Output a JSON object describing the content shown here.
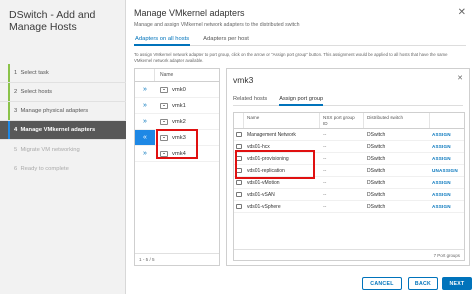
{
  "wizard": {
    "title": "DSwitch - Add and Manage Hosts",
    "steps": [
      {
        "num": "1",
        "label": "Select task"
      },
      {
        "num": "2",
        "label": "Select hosts"
      },
      {
        "num": "3",
        "label": "Manage physical adapters"
      },
      {
        "num": "4",
        "label": "Manage VMkernel adapters"
      },
      {
        "num": "5",
        "label": "Migrate VM networking"
      },
      {
        "num": "6",
        "label": "Ready to complete"
      }
    ]
  },
  "page": {
    "title": "Manage VMkernel adapters",
    "subtitle": "Manage and assign VMkernel network adapters to the distributed switch",
    "tabs": [
      "Adapters on all hosts",
      "Adapters per host"
    ],
    "instructions": "To assign VMkernel network adapter to port group, click on the arrow or \"Assign port group\" button. This assignment would be applied to all hosts that have the same VMkernel network adapter available."
  },
  "vmk_table": {
    "header": "Name",
    "rows": [
      "vmk0",
      "vmk1",
      "vmk2",
      "vmk3",
      "vmk4"
    ],
    "footer": "1 - 5 / 5"
  },
  "detail": {
    "title": "vmk3",
    "tabs": [
      "Related hosts",
      "Assign port group"
    ],
    "columns": [
      "Name",
      "NSX port group ID",
      "Distributed switch",
      ""
    ],
    "rows": [
      {
        "name": "Management Network",
        "nsx": "--",
        "switch": "DSwitch",
        "action": "ASSIGN"
      },
      {
        "name": "vds01-hcx",
        "nsx": "--",
        "switch": "DSwitch",
        "action": "ASSIGN"
      },
      {
        "name": "vds01-provisioning",
        "nsx": "--",
        "switch": "DSwitch",
        "action": "ASSIGN"
      },
      {
        "name": "vds01-replication",
        "nsx": "--",
        "switch": "DSwitch",
        "action": "UNASSIGN"
      },
      {
        "name": "vds01-vMotion",
        "nsx": "--",
        "switch": "DSwitch",
        "action": "ASSIGN"
      },
      {
        "name": "vds01-vSAN",
        "nsx": "--",
        "switch": "DSwitch",
        "action": "ASSIGN"
      },
      {
        "name": "vds01-vSphere",
        "nsx": "--",
        "switch": "DSwitch",
        "action": "ASSIGN"
      }
    ],
    "footer_count": "7 Port groups"
  },
  "buttons": {
    "cancel": "CANCEL",
    "back": "BACK",
    "next": "NEXT"
  },
  "colors": {
    "accent": "#0073bb",
    "highlight": "#e01010",
    "active_step_bg": "#585858"
  }
}
